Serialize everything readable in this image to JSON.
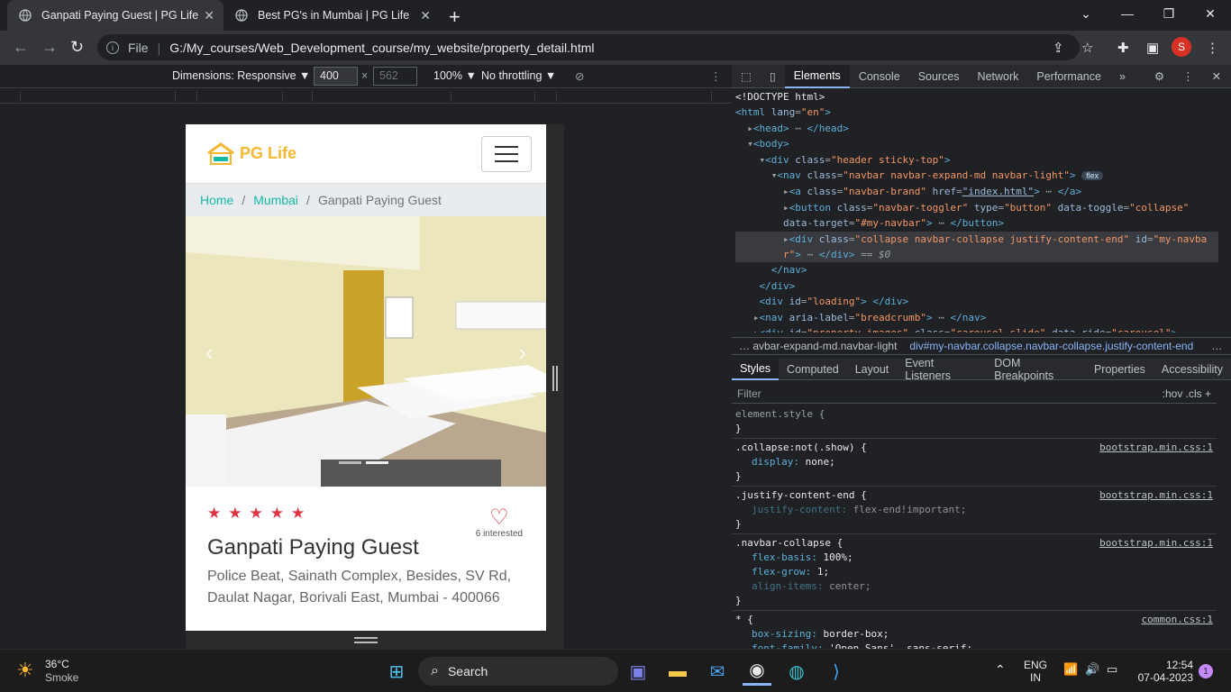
{
  "tabs": [
    {
      "title": "Ganpati Paying Guest | PG Life",
      "close": "✕"
    },
    {
      "title": "Best PG's in Mumbai | PG Life",
      "close": "✕"
    }
  ],
  "new_tab": "+",
  "window_controls": {
    "dropdown": "⌄",
    "minimize": "—",
    "restore": "❐",
    "close": "✕"
  },
  "address": {
    "scheme": "File",
    "url": "G:/My_courses/Web_Development_course/my_website/property_detail.html"
  },
  "profile_initial": "S",
  "device_toolbar": {
    "dimensions": "Dimensions: Responsive ▼",
    "width": "400",
    "x": "×",
    "height": "562",
    "zoom": "100% ▼",
    "throttle": "No throttling ▼"
  },
  "page": {
    "brand": "PG Life",
    "breadcrumb": [
      "Home",
      "Mumbai",
      "Ganpati Paying Guest"
    ],
    "crumb_sep": "/",
    "rating": 5,
    "star": "★",
    "heart": "♡",
    "interested": "6 interested",
    "name": "Ganpati Paying Guest",
    "address_line1": "Police Beat, Sainath Complex, Besides, SV Rd,",
    "address_line2": "Daulat Nagar, Borivali East, Mumbai - 400066",
    "prev": "‹",
    "next": "›"
  },
  "devtools": {
    "tabs": [
      "Elements",
      "Console",
      "Sources",
      "Network",
      "Performance",
      "»"
    ],
    "style_tabs": [
      "Styles",
      "Computed",
      "Layout",
      "Event Listeners",
      "DOM Breakpoints",
      "Properties",
      "Accessibility"
    ],
    "filter_placeholder": "Filter",
    "filter_right": ":hov  .cls  +",
    "breadcrumb_a": "…  avbar-expand-md.navbar-light",
    "breadcrumb_b": "div#my-navbar.collapse.navbar-collapse.justify-content-end",
    "breadcrumb_more": "…"
  },
  "taskbar": {
    "weather_temp": "36°C",
    "weather_desc": "Smoke",
    "search": "Search",
    "lang_1": "ENG",
    "lang_2": "IN",
    "time": "12:54",
    "date": "07-04-2023",
    "notif": "1"
  },
  "colors": {
    "accent": "#8ab4f8",
    "brand": "#16b9a6",
    "star": "#dc3545"
  }
}
